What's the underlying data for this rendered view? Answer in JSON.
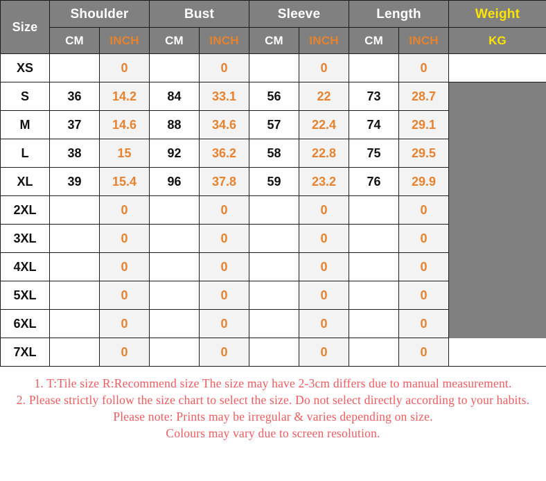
{
  "table": {
    "size_header": "Size",
    "groups": [
      {
        "label": "Shoulder",
        "units": [
          "CM",
          "INCH"
        ]
      },
      {
        "label": "Bust",
        "units": [
          "CM",
          "INCH"
        ]
      },
      {
        "label": "Sleeve",
        "units": [
          "CM",
          "INCH"
        ]
      },
      {
        "label": "Length",
        "units": [
          "CM",
          "INCH"
        ]
      }
    ],
    "weight": {
      "label": "Weight",
      "unit": "KG"
    },
    "rows": [
      {
        "size": "XS",
        "shoulder_cm": "",
        "shoulder_inch": "0",
        "bust_cm": "",
        "bust_inch": "0",
        "sleeve_cm": "",
        "sleeve_inch": "0",
        "length_cm": "",
        "length_inch": "0",
        "weight_kg": "",
        "weight_filled": false
      },
      {
        "size": "S",
        "shoulder_cm": "36",
        "shoulder_inch": "14.2",
        "bust_cm": "84",
        "bust_inch": "33.1",
        "sleeve_cm": "56",
        "sleeve_inch": "22",
        "length_cm": "73",
        "length_inch": "28.7",
        "weight_kg": "",
        "weight_filled": true
      },
      {
        "size": "M",
        "shoulder_cm": "37",
        "shoulder_inch": "14.6",
        "bust_cm": "88",
        "bust_inch": "34.6",
        "sleeve_cm": "57",
        "sleeve_inch": "22.4",
        "length_cm": "74",
        "length_inch": "29.1",
        "weight_kg": "",
        "weight_filled": true
      },
      {
        "size": "L",
        "shoulder_cm": "38",
        "shoulder_inch": "15",
        "bust_cm": "92",
        "bust_inch": "36.2",
        "sleeve_cm": "58",
        "sleeve_inch": "22.8",
        "length_cm": "75",
        "length_inch": "29.5",
        "weight_kg": "",
        "weight_filled": true
      },
      {
        "size": "XL",
        "shoulder_cm": "39",
        "shoulder_inch": "15.4",
        "bust_cm": "96",
        "bust_inch": "37.8",
        "sleeve_cm": "59",
        "sleeve_inch": "23.2",
        "length_cm": "76",
        "length_inch": "29.9",
        "weight_kg": "",
        "weight_filled": true
      },
      {
        "size": "2XL",
        "shoulder_cm": "",
        "shoulder_inch": "0",
        "bust_cm": "",
        "bust_inch": "0",
        "sleeve_cm": "",
        "sleeve_inch": "0",
        "length_cm": "",
        "length_inch": "0",
        "weight_kg": "",
        "weight_filled": true
      },
      {
        "size": "3XL",
        "shoulder_cm": "",
        "shoulder_inch": "0",
        "bust_cm": "",
        "bust_inch": "0",
        "sleeve_cm": "",
        "sleeve_inch": "0",
        "length_cm": "",
        "length_inch": "0",
        "weight_kg": "",
        "weight_filled": true
      },
      {
        "size": "4XL",
        "shoulder_cm": "",
        "shoulder_inch": "0",
        "bust_cm": "",
        "bust_inch": "0",
        "sleeve_cm": "",
        "sleeve_inch": "0",
        "length_cm": "",
        "length_inch": "0",
        "weight_kg": "",
        "weight_filled": true
      },
      {
        "size": "5XL",
        "shoulder_cm": "",
        "shoulder_inch": "0",
        "bust_cm": "",
        "bust_inch": "0",
        "sleeve_cm": "",
        "sleeve_inch": "0",
        "length_cm": "",
        "length_inch": "0",
        "weight_kg": "",
        "weight_filled": true
      },
      {
        "size": "6XL",
        "shoulder_cm": "",
        "shoulder_inch": "0",
        "bust_cm": "",
        "bust_inch": "0",
        "sleeve_cm": "",
        "sleeve_inch": "0",
        "length_cm": "",
        "length_inch": "0",
        "weight_kg": "",
        "weight_filled": true
      },
      {
        "size": "7XL",
        "shoulder_cm": "",
        "shoulder_inch": "0",
        "bust_cm": "",
        "bust_inch": "0",
        "sleeve_cm": "",
        "sleeve_inch": "0",
        "length_cm": "",
        "length_inch": "0",
        "weight_kg": "",
        "weight_filled": false
      }
    ]
  },
  "notes": [
    "1. T:Tile size R:Recommend size The size may have 2-3cm differs due to manual measurement.",
    "2. Please strictly follow the size chart to select the size. Do not select directly according to your habits.",
    "Please note: Prints may be irregular & varies depending on size.",
    "Colours may vary due to screen resolution."
  ],
  "colors": {
    "header_gray": "#808080",
    "inch_orange": "#e8822e",
    "weight_yellow": "#ffe400",
    "note_red": "#f25a5e",
    "inch_cell_bg": "#f3f3f3",
    "grid_line": "#1b1b1b"
  }
}
